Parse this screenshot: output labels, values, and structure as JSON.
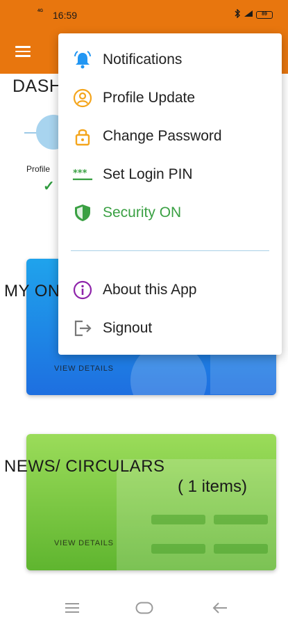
{
  "status_bar": {
    "network": "4G",
    "time": "16:59",
    "battery": "89"
  },
  "dashboard": {
    "title": "DASH",
    "profile_label": "Profile",
    "profile_check": "✓",
    "cards": {
      "my": {
        "title": "MY ON",
        "view_details": "VIEW DETAILS"
      },
      "news": {
        "title": "NEWS/ CIRCULARS",
        "count": "( 1 items)",
        "view_details": "VIEW DETAILS"
      }
    }
  },
  "menu": {
    "items": [
      {
        "label": "Notifications",
        "icon": "bell-icon"
      },
      {
        "label": "Profile Update",
        "icon": "user-circle-icon"
      },
      {
        "label": "Change Password",
        "icon": "lock-icon"
      },
      {
        "label": "Set Login PIN",
        "icon": "pin-asterisk-icon"
      },
      {
        "label": "Security ON",
        "icon": "shield-icon"
      },
      {
        "label": "About this App",
        "icon": "info-icon"
      },
      {
        "label": "Signout",
        "icon": "signout-icon"
      }
    ]
  },
  "colors": {
    "primary": "#e8760e",
    "menu_blue": "#2196f3",
    "menu_orange": "#f4a51c",
    "menu_green": "#3aa043",
    "menu_purple": "#8e24aa",
    "menu_gray": "#777777"
  }
}
